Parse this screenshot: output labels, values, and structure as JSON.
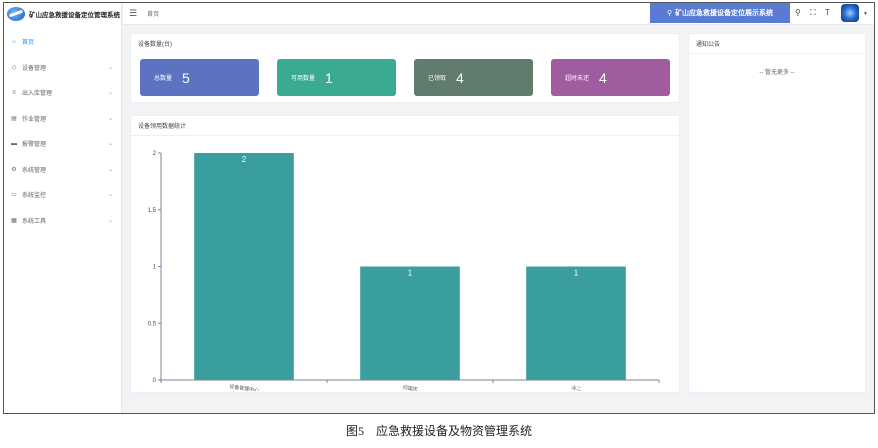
{
  "brand": {
    "title": "矿山应急救援设备定位管理系统"
  },
  "header": {
    "breadcrumb": "首页",
    "system_button": "矿山应急救援设备定位展示系统"
  },
  "sidebar": {
    "items": [
      {
        "label": "首页",
        "icon": "home-icon",
        "active": true
      },
      {
        "label": "设备管理",
        "icon": "device-icon"
      },
      {
        "label": "出入库管理",
        "icon": "storage-icon"
      },
      {
        "label": "作业管理",
        "icon": "task-icon"
      },
      {
        "label": "报警管理",
        "icon": "alarm-icon"
      },
      {
        "label": "系统管理",
        "icon": "gear-icon"
      },
      {
        "label": "系统监控",
        "icon": "monitor-icon"
      },
      {
        "label": "系统工具",
        "icon": "tool-icon"
      }
    ]
  },
  "device_count": {
    "title": "设备数量(台)",
    "cards": [
      {
        "label": "总数量",
        "value": "5",
        "color": "#5b73c1"
      },
      {
        "label": "可用数量",
        "value": "1",
        "color": "#3aaa93"
      },
      {
        "label": "已领取",
        "value": "4",
        "color": "#617b6d"
      },
      {
        "label": "超时未还",
        "value": "4",
        "color": "#9f5d9f"
      }
    ]
  },
  "notice": {
    "title": "通知公告",
    "empty_text": "-- 暂无更多 --"
  },
  "chart_panel": {
    "title": "设备领用数据统计"
  },
  "chart_data": {
    "type": "bar",
    "categories": [
      "设备管理中心",
      "闫国庆",
      "冰二"
    ],
    "values": [
      2,
      1,
      1
    ],
    "ylim": [
      0,
      2
    ],
    "yticks": [
      "0",
      "0.5",
      "1",
      "1.5",
      "2"
    ],
    "bar_color": "#3a9e9e",
    "grid": false
  },
  "caption": "图5　应急救援设备及物资管理系统"
}
